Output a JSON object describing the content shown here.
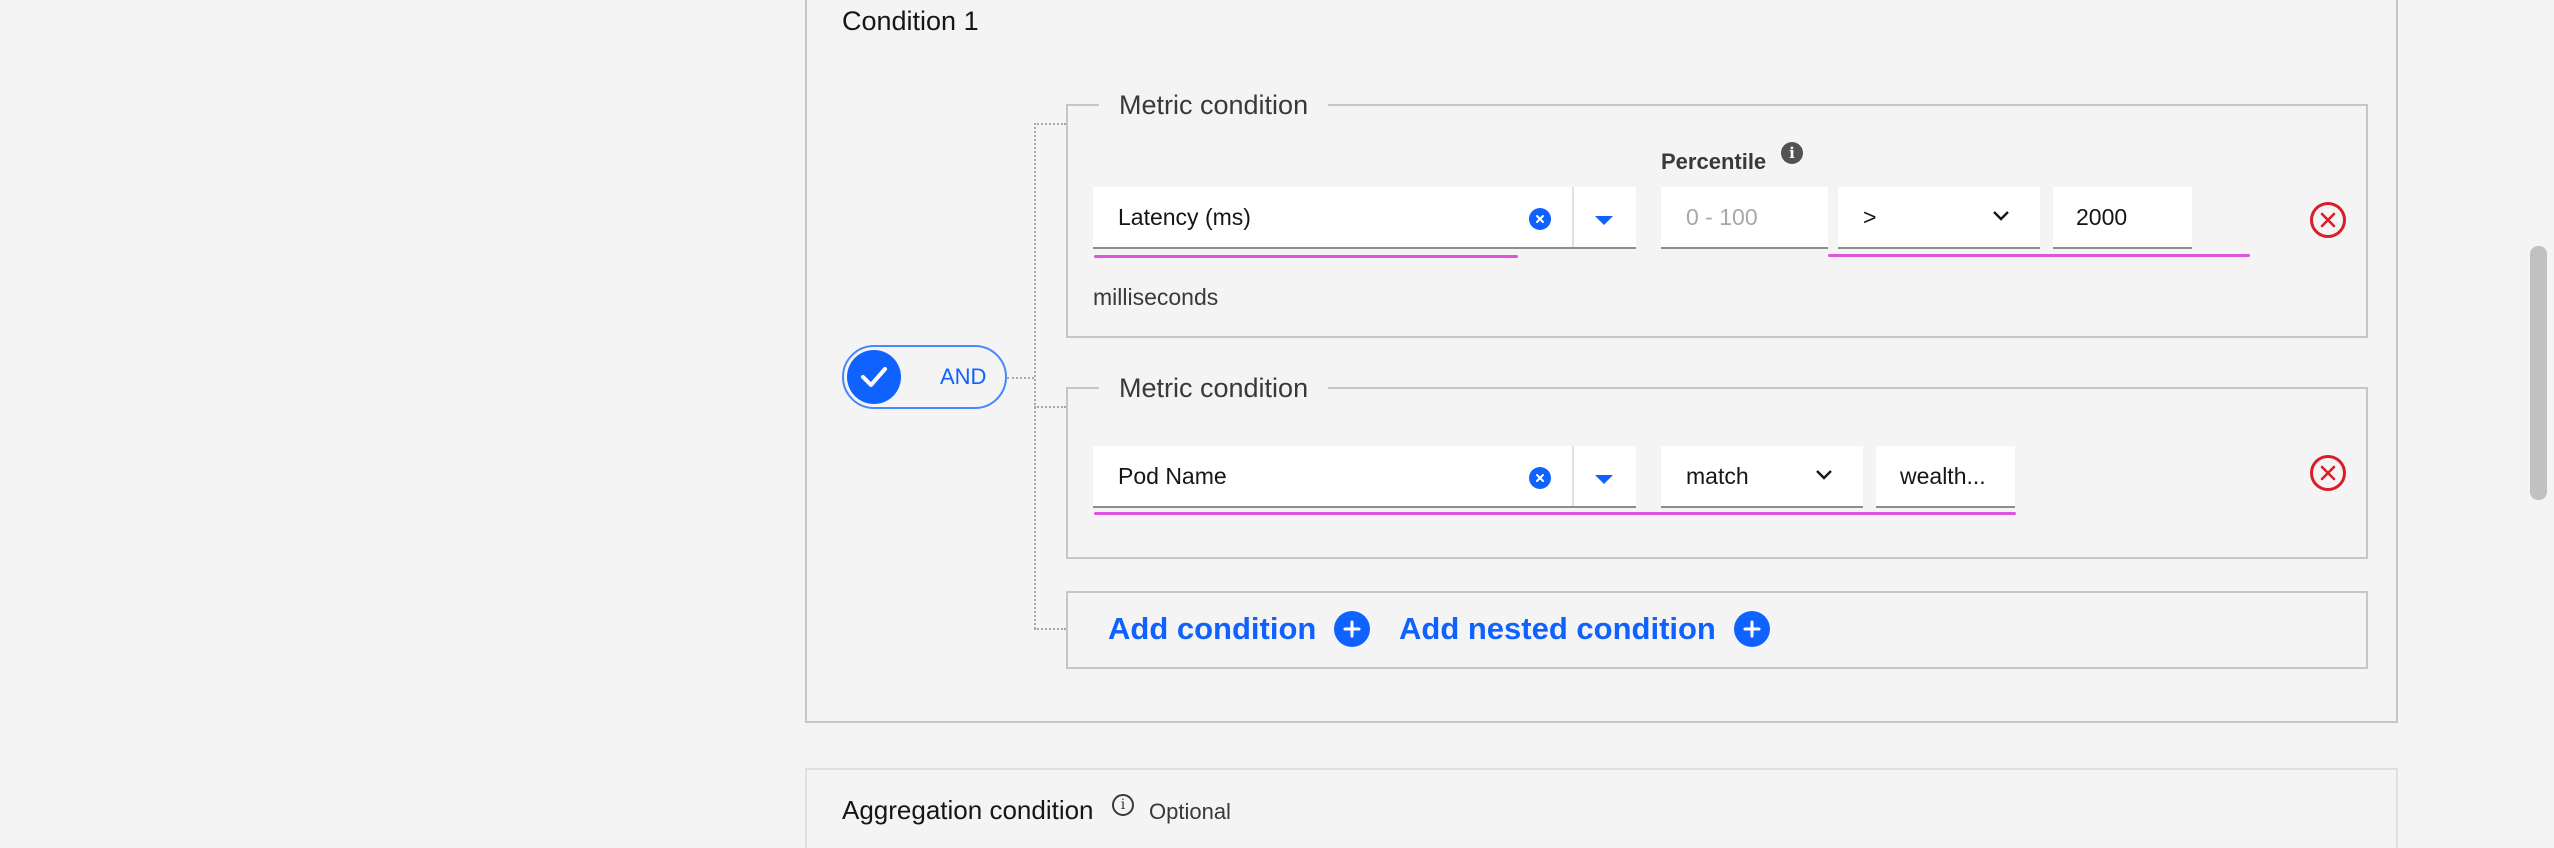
{
  "condition_group": {
    "title": "Condition 1",
    "logic_toggle": {
      "label": "AND",
      "checked": true
    }
  },
  "metric_conditions": [
    {
      "legend": "Metric condition",
      "metric_value": "Latency (ms)",
      "percentile_label": "Percentile",
      "percentile_placeholder": "0 - 100",
      "operator_value": ">",
      "threshold_value": "2000",
      "unit_text": "milliseconds"
    },
    {
      "legend": "Metric condition",
      "metric_value": "Pod Name",
      "operator_value": "match",
      "match_value": "wealth..."
    }
  ],
  "actions": {
    "add_condition_label": "Add condition",
    "add_nested_condition_label": "Add nested condition"
  },
  "aggregation": {
    "title": "Aggregation condition",
    "optional_label": "Optional"
  },
  "colors": {
    "accent": "#0f62fe",
    "danger": "#da1e28",
    "highlight": "#e052e0"
  }
}
